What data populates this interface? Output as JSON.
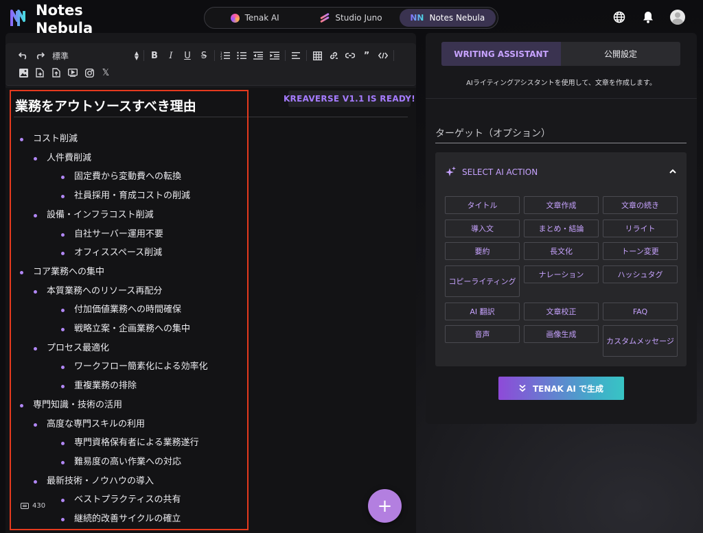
{
  "logo": {
    "line1": "Notes",
    "line2": "Nebula"
  },
  "app_tabs": [
    {
      "label": "Tenak AI",
      "icon": "tenak-ai-icon"
    },
    {
      "label": "Studio Juno",
      "icon": "studio-juno-icon"
    },
    {
      "label": "Notes Nebula",
      "icon": "notes-nebula-icon",
      "active": true
    }
  ],
  "top_icons": [
    "globe-icon",
    "bell-icon",
    "avatar"
  ],
  "toolbar": {
    "block_style": "標準",
    "buttons": [
      "undo-icon",
      "redo-icon",
      "bold",
      "italic",
      "underline",
      "strikethrough",
      "ordered-list-icon",
      "bullet-list-icon",
      "outdent-icon",
      "indent-icon",
      "align-icon",
      "table-icon",
      "link-icon",
      "unlink-icon",
      "quote-icon",
      "code-icon",
      "image-icon",
      "file-icon",
      "upload-icon",
      "video-icon",
      "instagram-icon",
      "x-icon"
    ],
    "bold_label": "B",
    "italic_label": "I",
    "underline_label": "U",
    "strike_label": "S",
    "quote_label": "”",
    "x_label": "𝕏"
  },
  "banner": "KREAVERSE V1.1 IS READY!",
  "document": {
    "title": "業務をアウトソースすべき理由",
    "outline": [
      {
        "level": 0,
        "text": "コスト削減"
      },
      {
        "level": 1,
        "text": "人件費削減"
      },
      {
        "level": 2,
        "text": "固定費から変動費への転換"
      },
      {
        "level": 2,
        "text": "社員採用・育成コストの削減"
      },
      {
        "level": 1,
        "text": "設備・インフラコスト削減"
      },
      {
        "level": 2,
        "text": "自社サーバー運用不要"
      },
      {
        "level": 2,
        "text": "オフィススペース削減"
      },
      {
        "level": 0,
        "text": "コア業務への集中"
      },
      {
        "level": 1,
        "text": "本質業務へのリソース再配分"
      },
      {
        "level": 2,
        "text": "付加価値業務への時間確保"
      },
      {
        "level": 2,
        "text": "戦略立案・企画業務への集中"
      },
      {
        "level": 1,
        "text": "プロセス最適化"
      },
      {
        "level": 2,
        "text": "ワークフロー簡素化による効率化"
      },
      {
        "level": 2,
        "text": "重複業務の排除"
      },
      {
        "level": 0,
        "text": "専門知識・技術の活用"
      },
      {
        "level": 1,
        "text": "高度な専門スキルの利用"
      },
      {
        "level": 2,
        "text": "専門資格保有者による業務遂行"
      },
      {
        "level": 2,
        "text": "難易度の高い作業への対応"
      },
      {
        "level": 1,
        "text": "最新技術・ノウハウの導入"
      },
      {
        "level": 2,
        "text": "ベストプラクティスの共有"
      },
      {
        "level": 2,
        "text": "継続的改善サイクルの確立"
      }
    ]
  },
  "word_count": "430",
  "fab_label": "+",
  "assistant": {
    "tabs": [
      {
        "label": "WRITING ASSISTANT",
        "active": true
      },
      {
        "label": "公開設定"
      }
    ],
    "description": "AIライティングアシスタントを使用して、文章を作成します。",
    "target_placeholder": "ターゲット（オプション）",
    "target_value": "",
    "action_header": "SELECT AI ACTION",
    "actions": [
      [
        "タイトル",
        "文章作成",
        "文章の続き"
      ],
      [
        "導入文",
        "まとめ・結論",
        "リライト"
      ],
      [
        "要約",
        "長文化",
        "トーン変更"
      ],
      [
        "コピーライティング",
        "ナレーション",
        "ハッシュタグ"
      ],
      [
        "AI 翻訳",
        "文章校正",
        "FAQ"
      ],
      [
        "音声",
        "画像生成",
        "カスタムメッセージ"
      ]
    ],
    "generate_label": "TENAK AI で生成"
  },
  "colors": {
    "accent_purple": "#b187f5",
    "selection_border": "#e63a1e",
    "generate_gradient_start": "#8e4ad8",
    "generate_gradient_end": "#38c4c4"
  }
}
